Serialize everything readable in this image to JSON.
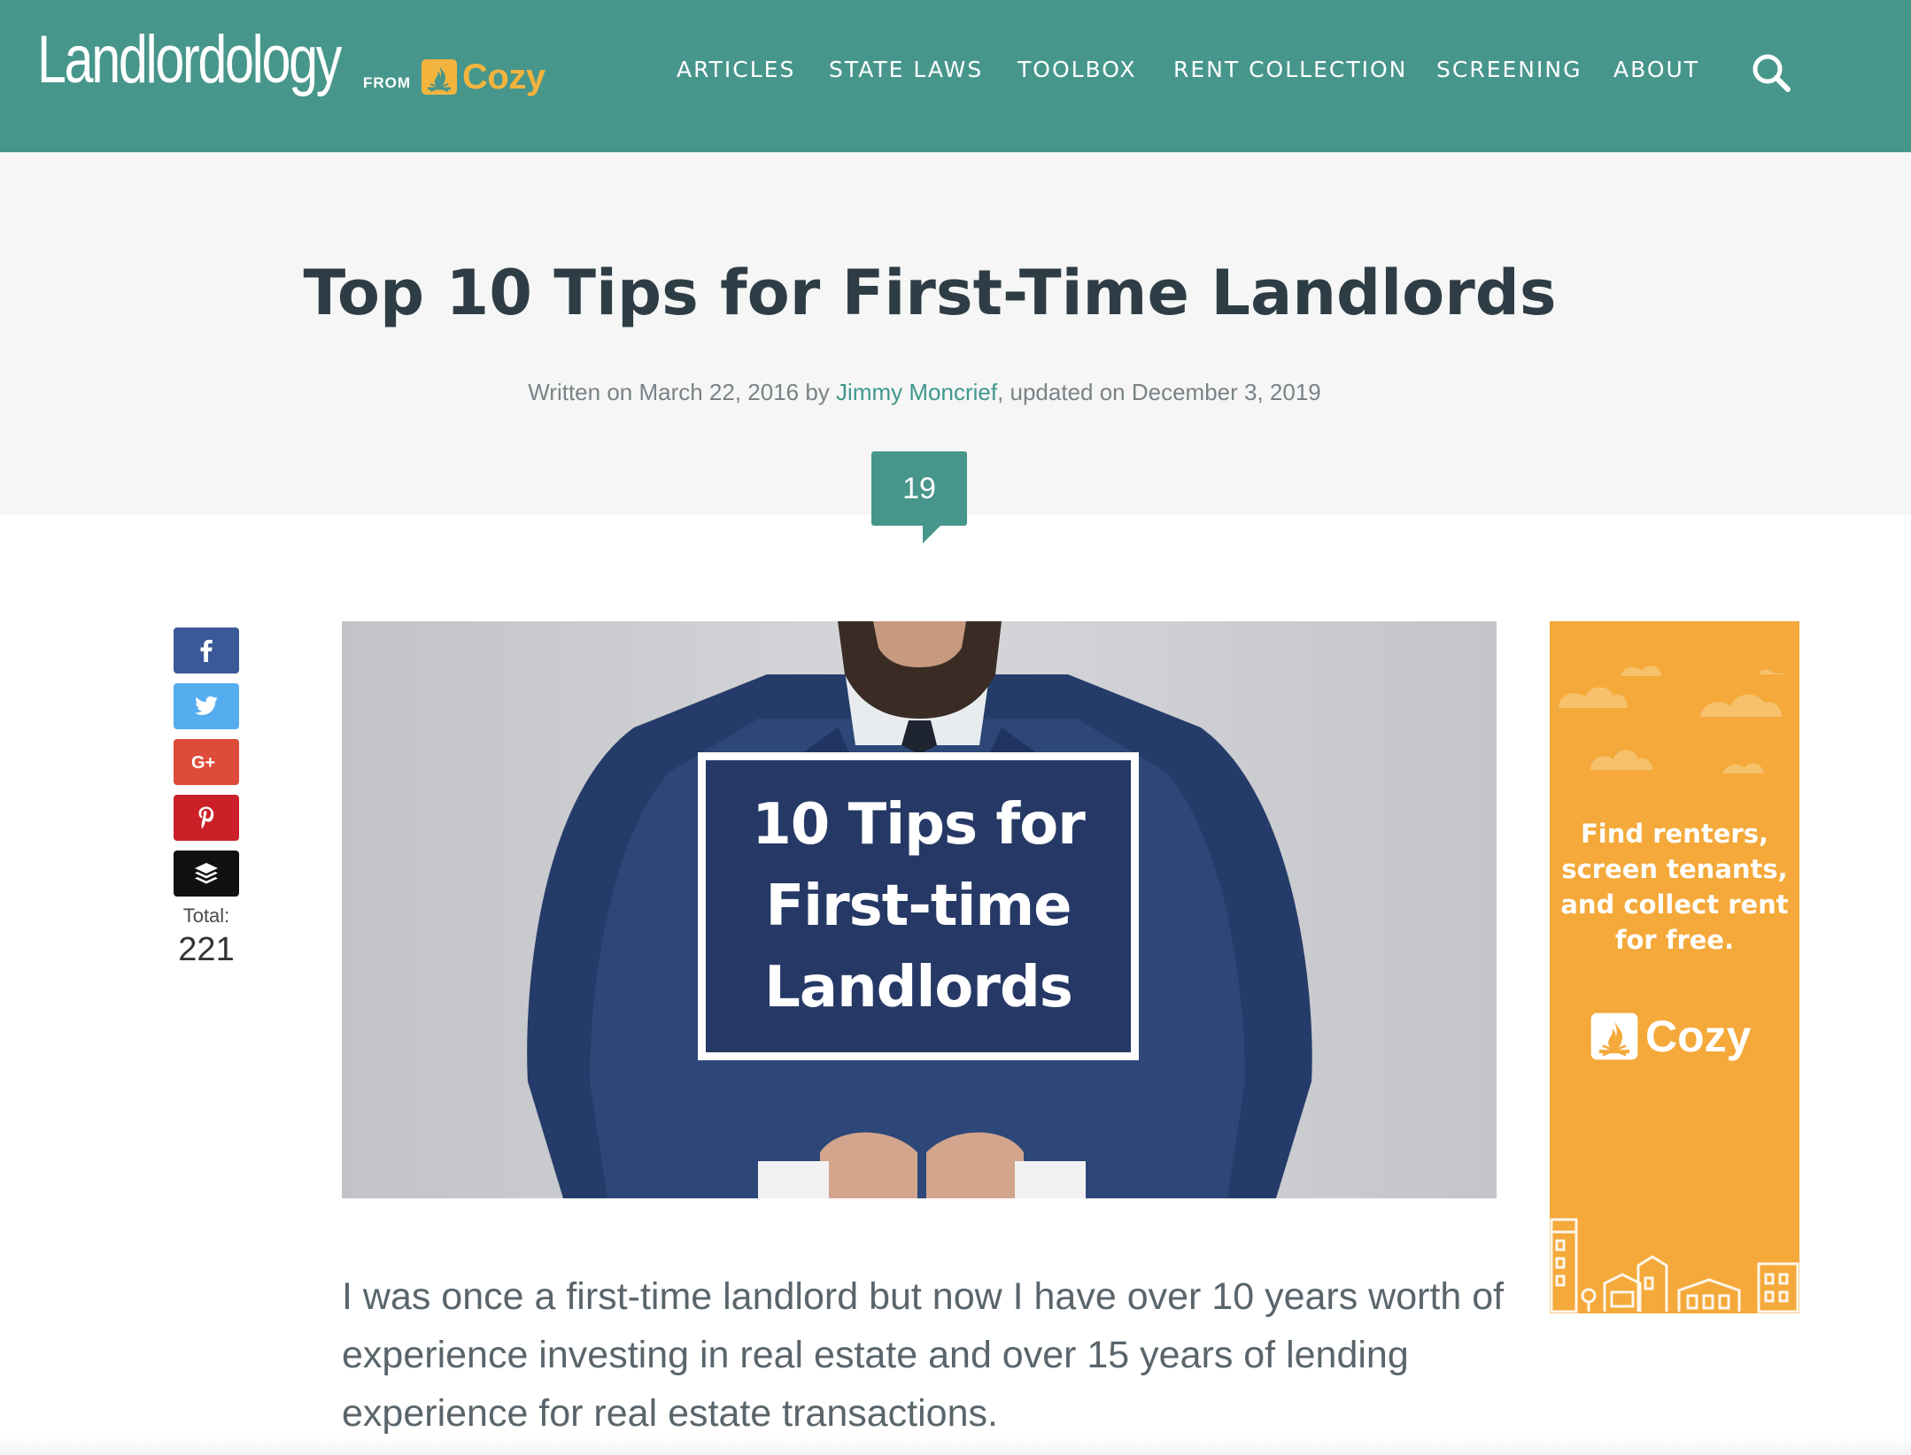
{
  "header": {
    "brand": "Landlordology",
    "from_label": "FROM",
    "partner": "Cozy",
    "nav": [
      "ARTICLES",
      "STATE LAWS",
      "TOOLBOX",
      "RENT COLLECTION",
      "SCREENING",
      "ABOUT"
    ],
    "search_icon": "search-icon"
  },
  "article": {
    "title": "Top 10 Tips for First-Time Landlords",
    "byline": {
      "written_prefix": "Written on March 22, 2016 by ",
      "author": "Jimmy Moncrief",
      "updated_suffix": ", updated on December 3, 2019"
    },
    "comment_count": "19",
    "hero_sign": "10 Tips for\nFirst-time\nLandlords",
    "intro": "I was once a first-time landlord but now I have over 10 years worth of experience investing in real estate and over 15 years of lending experience for real estate transactions."
  },
  "share": {
    "buttons": [
      {
        "network": "facebook",
        "icon": "facebook-icon",
        "color": "#3b5998"
      },
      {
        "network": "twitter",
        "icon": "twitter-icon",
        "color": "#55acee"
      },
      {
        "network": "google-plus",
        "icon": "google-plus-icon",
        "color": "#dd4b39"
      },
      {
        "network": "pinterest",
        "icon": "pinterest-icon",
        "color": "#cb2027"
      },
      {
        "network": "buffer",
        "icon": "buffer-icon",
        "color": "#111111"
      }
    ],
    "total_label": "Total:",
    "total": "221"
  },
  "ad": {
    "text": "Find renters, screen tenants, and collect rent for free.",
    "brand": "Cozy",
    "background": "#f4a93a"
  },
  "colors": {
    "header_bg": "#47968c",
    "accent": "#3f978d",
    "cozy_yellow": "#f3b43e"
  }
}
